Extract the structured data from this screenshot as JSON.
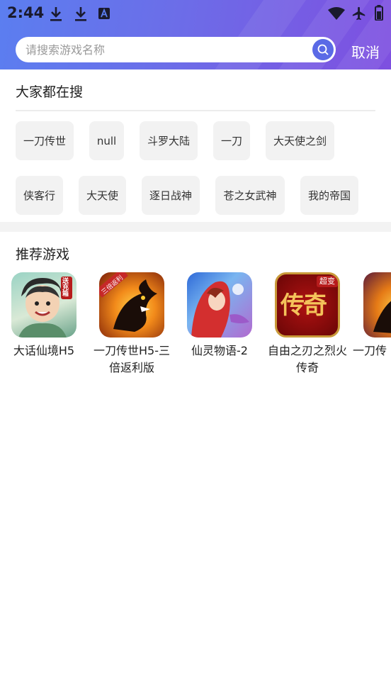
{
  "status_bar": {
    "time": "2:44",
    "left_icons": [
      "download-icon",
      "download-icon",
      "translate-a-icon"
    ],
    "right_icons": [
      "wifi-icon",
      "airplane-icon",
      "battery-icon"
    ]
  },
  "search": {
    "placeholder": "请搜索游戏名称",
    "value": "",
    "cancel_label": "取消"
  },
  "hot_search": {
    "title": "大家都在搜",
    "tags": [
      "一刀传世",
      "null",
      "斗罗大陆",
      "一刀",
      "大天使之剑",
      "侠客行",
      "大天使",
      "逐日战神",
      "苍之女武神",
      "我的帝国"
    ]
  },
  "recommended": {
    "title": "推荐游戏",
    "games": [
      {
        "name": "大话仙境H5",
        "badge": "送充箱"
      },
      {
        "name": "一刀传世H5-三倍返利版",
        "badge": "三倍返利"
      },
      {
        "name": "仙灵物语-2",
        "badge": ""
      },
      {
        "name": "自由之刃之烈火传奇",
        "badge": "超变",
        "logo_text": "传奇"
      },
      {
        "name": "一刀传",
        "badge": ""
      }
    ]
  },
  "colors": {
    "header_start": "#5b7ef0",
    "header_end": "#7e4fe0",
    "search_button": "#5a6ae6",
    "tag_bg": "#f2f2f2"
  }
}
